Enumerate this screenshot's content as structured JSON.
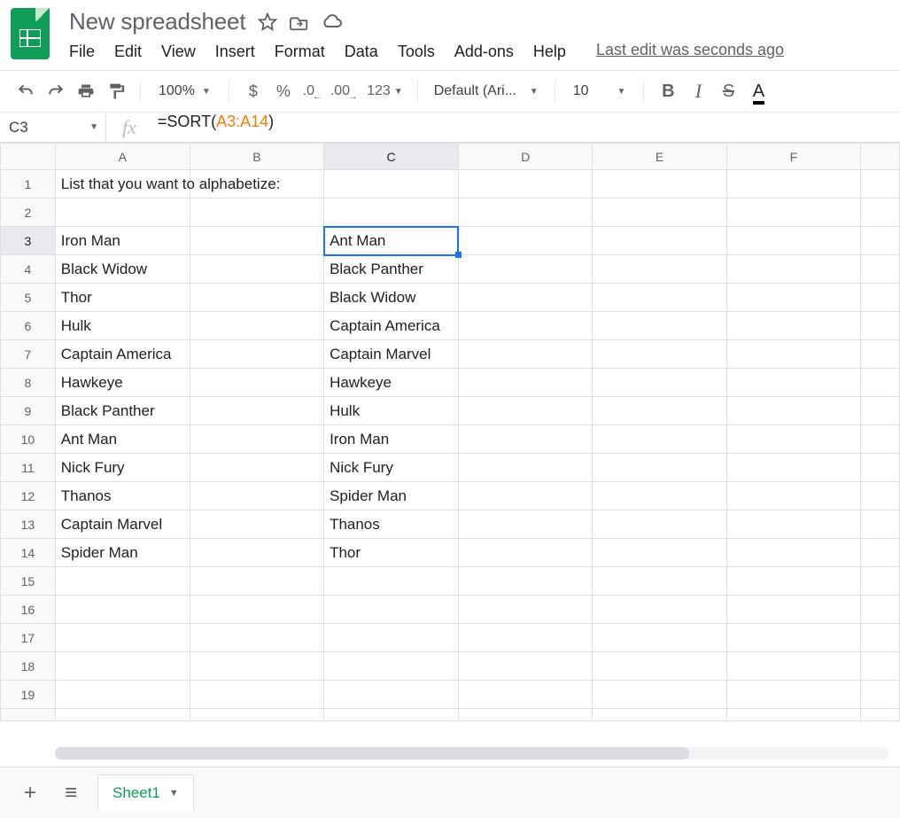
{
  "doc_title": "New spreadsheet",
  "last_edit": "Last edit was seconds ago",
  "menu": [
    "File",
    "Edit",
    "View",
    "Insert",
    "Format",
    "Data",
    "Tools",
    "Add-ons",
    "Help"
  ],
  "toolbar": {
    "zoom": "100%",
    "currency": "$",
    "percent": "%",
    "dec_dec": ".0",
    "inc_dec": ".00",
    "more_formats": "123",
    "font": "Default (Ari...",
    "font_size": "10"
  },
  "name_box": "C3",
  "formula": {
    "prefix": "=SORT(",
    "range": "A3:A14",
    "suffix": ")"
  },
  "columns": [
    "A",
    "B",
    "C",
    "D",
    "E",
    "F"
  ],
  "rows_visible": 19,
  "active_cell": {
    "row": 3,
    "col": "C"
  },
  "cells": {
    "A1": "List that you want to alphabetize:",
    "A3": "Iron Man",
    "A4": "Black Widow",
    "A5": "Thor",
    "A6": "Hulk",
    "A7": "Captain America",
    "A8": "Hawkeye",
    "A9": "Black Panther",
    "A10": "Ant Man",
    "A11": "Nick Fury",
    "A12": "Thanos",
    "A13": "Captain Marvel",
    "A14": "Spider Man",
    "C3": "Ant Man",
    "C4": "Black Panther",
    "C5": "Black Widow",
    "C6": "Captain America",
    "C7": "Captain Marvel",
    "C8": "Hawkeye",
    "C9": "Hulk",
    "C10": "Iron Man",
    "C11": "Nick Fury",
    "C12": "Spider Man",
    "C13": "Thanos",
    "C14": "Thor"
  },
  "sheet_tab": "Sheet1"
}
